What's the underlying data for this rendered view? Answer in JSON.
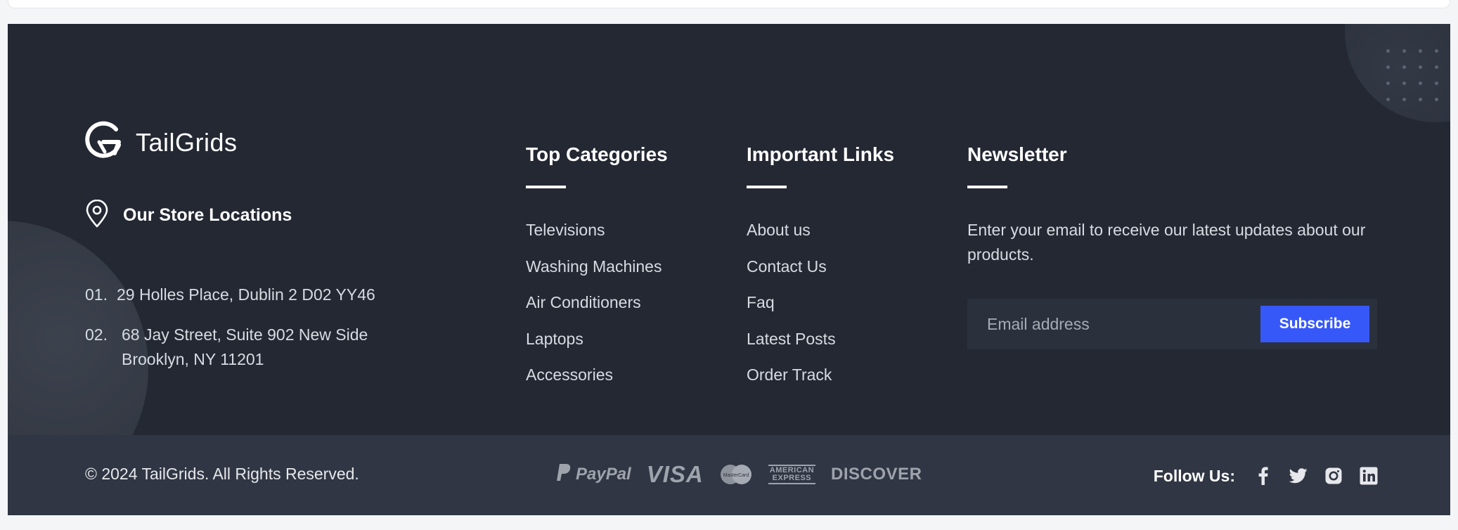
{
  "brand": {
    "name": "TailGrids",
    "logo_icon": "tailgrids-logo-icon"
  },
  "store": {
    "title": "Our Store Locations",
    "icon": "map-pin-icon",
    "addresses": [
      {
        "num": "01.",
        "line1": "29 Holles Place, Dublin 2 D02 YY46",
        "line2": ""
      },
      {
        "num": "02.",
        "line1": "68 Jay Street, Suite 902 New Side",
        "line2": "Brooklyn, NY 11201"
      }
    ]
  },
  "categories": {
    "title": "Top Categories",
    "items": [
      "Televisions",
      "Washing Machines",
      "Air Conditioners",
      "Laptops",
      "Accessories"
    ]
  },
  "important_links": {
    "title": "Important Links",
    "items": [
      "About us",
      "Contact Us",
      "Faq",
      "Latest Posts",
      "Order Track"
    ]
  },
  "newsletter": {
    "title": "Newsletter",
    "text": "Enter your email to receive our latest updates about our products.",
    "placeholder": "Email address",
    "value": "",
    "button_label": "Subscribe"
  },
  "bottom": {
    "copyright": "© 2024 TailGrids. All Rights Reserved.",
    "payments": {
      "paypal": "PayPal",
      "visa": "VISA",
      "mastercard": "MasterCard",
      "amex_line1": "AMERICAN",
      "amex_line2": "EXPRESS",
      "discover": "DISCOVER"
    },
    "follow_label": "Follow Us:",
    "social_icons": [
      "facebook-icon",
      "twitter-icon",
      "instagram-icon",
      "linkedin-icon"
    ]
  },
  "colors": {
    "footer_bg": "#232833",
    "bottom_bg": "#303643",
    "accent": "#3758f9",
    "text_muted": "#d7dbe2"
  }
}
